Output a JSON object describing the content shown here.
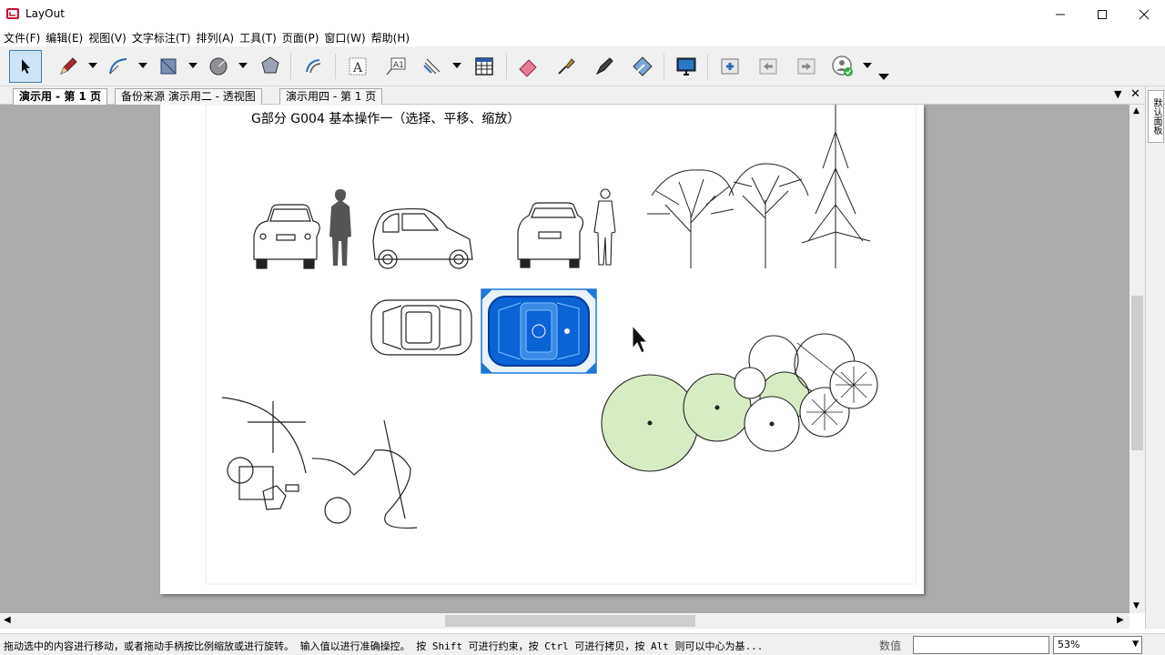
{
  "window": {
    "title": "LayOut"
  },
  "menu": [
    "文件(F)",
    "编辑(E)",
    "视图(V)",
    "文字标注(T)",
    "排列(A)",
    "工具(T)",
    "页面(P)",
    "窗口(W)",
    "帮助(H)"
  ],
  "toolbar": {
    "tools": [
      "select-tool",
      "line-tool",
      "arc-tool",
      "rectangle-tool",
      "circle-tool",
      "polygon-tool",
      "offset-tool",
      "text-tool",
      "label-tool",
      "dimension-tool",
      "table-tool",
      "eraser-tool",
      "style-tool",
      "split-tool",
      "join-tool",
      "presentation",
      "add-page",
      "previous-page",
      "next-page",
      "collaborate"
    ]
  },
  "tabs": [
    {
      "label": "演示用 - 第 1 页",
      "active": true
    },
    {
      "label": "备份来源 演示用二 - 透视图",
      "active": false
    },
    {
      "label": "演示用四 - 第 1 页",
      "active": false
    }
  ],
  "tray_tab": "默认面板",
  "page": {
    "heading": "G部分 G004 基本操作一（选择、平移、缩放）"
  },
  "statusbar": {
    "hint": "拖动选中的内容进行移动，或者拖动手柄按比例缩放或进行旋转。 输入值以进行准确操控。 按 Shift 可进行约束，按 Ctrl 可进行拷贝，按 Alt 则可以中心为基...",
    "value_label": "数值",
    "value": "",
    "zoom": "53%"
  },
  "colors": {
    "selection": "#1e78d8",
    "selection_fill": "#0b63d6",
    "shrub_fill": "#d7ecc5",
    "canvas": "#ababab"
  }
}
